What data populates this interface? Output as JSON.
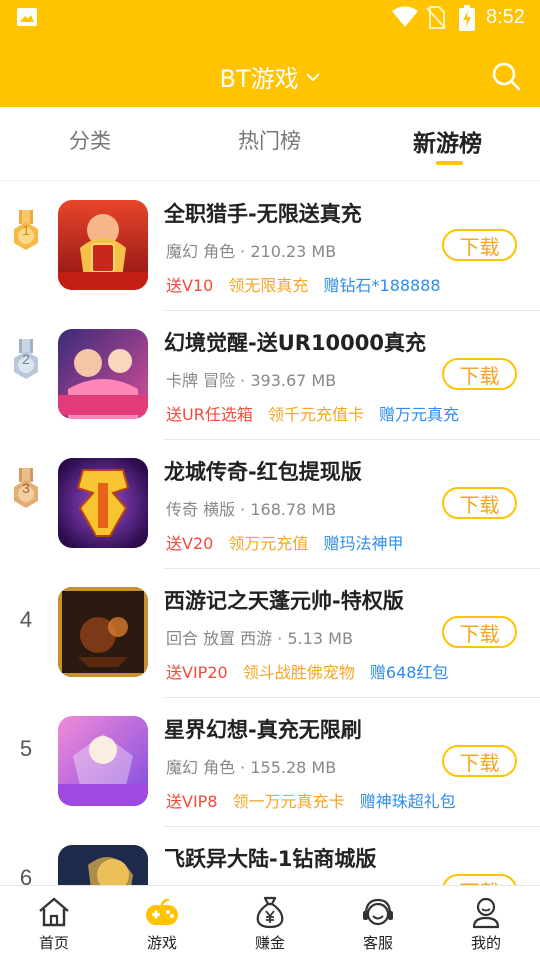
{
  "status_bar": {
    "time": "8:52"
  },
  "header": {
    "title": "BT游戏"
  },
  "tabs": [
    {
      "label": "分类"
    },
    {
      "label": "热门榜"
    },
    {
      "label": "新游榜"
    }
  ],
  "games": [
    {
      "rank": "1",
      "name": "全职猎手-无限送真充",
      "meta": "魔幻 角色 · 210.23 MB",
      "tags": [
        "送V10",
        "领无限真充",
        "赠钻石*188888"
      ],
      "button": "下载"
    },
    {
      "rank": "2",
      "name": "幻境觉醒-送UR10000真充",
      "meta": "卡牌 冒险 · 393.67 MB",
      "tags": [
        "送UR任选箱",
        "领千元充值卡",
        "赠万元真充"
      ],
      "button": "下载"
    },
    {
      "rank": "3",
      "name": "龙城传奇-红包提现版",
      "meta": "传奇 横版 · 168.78 MB",
      "tags": [
        "送V20",
        "领万元充值",
        "赠玛法神甲"
      ],
      "button": "下载"
    },
    {
      "rank": "4",
      "name": "西游记之天蓬元帅-特权版",
      "meta": "回合 放置 西游 · 5.13 MB",
      "tags": [
        "送VIP20",
        "领斗战胜佛宠物",
        "赠648红包"
      ],
      "button": "下载"
    },
    {
      "rank": "5",
      "name": "星界幻想-真充无限刷",
      "meta": "魔幻 角色 · 155.28 MB",
      "tags": [
        "送VIP8",
        "领一万元真充卡",
        "赠神珠超礼包"
      ],
      "button": "下载"
    },
    {
      "rank": "6",
      "name": "飞跃异大陆-1钻商城版",
      "meta": "",
      "tags": [],
      "button": "下载"
    }
  ],
  "bottom_nav": [
    {
      "label": "首页",
      "icon": "home-icon"
    },
    {
      "label": "游戏",
      "icon": "gamepad-icon"
    },
    {
      "label": "赚金",
      "icon": "money-bag-icon"
    },
    {
      "label": "客服",
      "icon": "headset-icon"
    },
    {
      "label": "我的",
      "icon": "user-icon"
    }
  ],
  "colors": {
    "brand": "#FFC300",
    "tag_red": "#F24A3A",
    "tag_orange": "#F5A623",
    "tag_blue": "#2F8DEB"
  }
}
